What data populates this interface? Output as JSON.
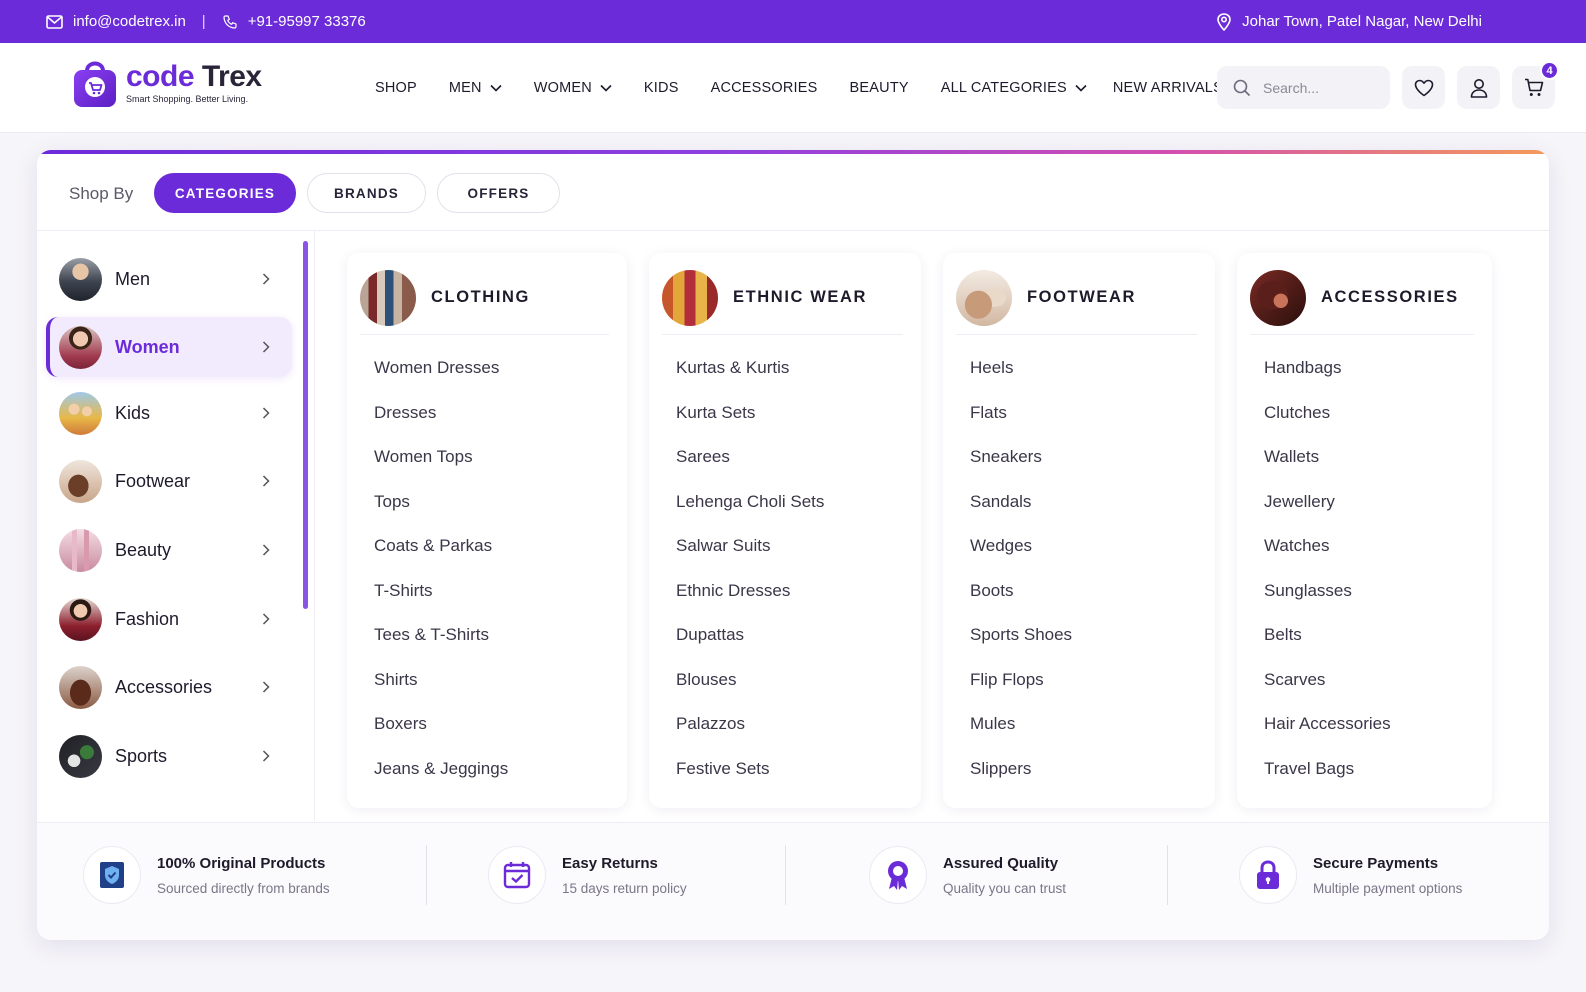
{
  "topbar": {
    "email": "info@codetrex.in",
    "separator": "|",
    "phone": "+91-95997 33376",
    "location": "Johar Town, Patel Nagar, New Delhi"
  },
  "brand": {
    "name_part1": "code",
    "name_part2": " Trex",
    "tagline": "Smart Shopping. Better Living."
  },
  "nav": {
    "items": [
      {
        "label": "SHOP",
        "dropdown": false
      },
      {
        "label": "MEN",
        "dropdown": true
      },
      {
        "label": "WOMEN",
        "dropdown": true
      },
      {
        "label": "KIDS",
        "dropdown": false
      },
      {
        "label": "ACCESSORIES",
        "dropdown": false
      },
      {
        "label": "BEAUTY",
        "dropdown": false
      },
      {
        "label": "ALL CATEGORIES",
        "dropdown": true
      },
      {
        "label": "NEW ARRIVALS",
        "dropdown": false
      }
    ]
  },
  "search": {
    "placeholder": "Search..."
  },
  "cart": {
    "count": "4"
  },
  "shop_by": {
    "label": "Shop By",
    "tabs": [
      "CATEGORIES",
      "BRANDS",
      "OFFERS"
    ],
    "active_tab": "CATEGORIES"
  },
  "sidebar": {
    "items": [
      {
        "label": "Men"
      },
      {
        "label": "Women"
      },
      {
        "label": "Kids"
      },
      {
        "label": "Footwear"
      },
      {
        "label": "Beauty"
      },
      {
        "label": "Fashion"
      },
      {
        "label": "Accessories"
      },
      {
        "label": "Sports"
      }
    ],
    "active": "Women"
  },
  "columns": [
    {
      "title": "CLOTHING",
      "items": [
        "Women Dresses",
        "Dresses",
        "Women Tops",
        "Tops",
        "Coats & Parkas",
        "T-Shirts",
        "Tees & T-Shirts",
        "Shirts",
        "Boxers",
        "Jeans & Jeggings"
      ]
    },
    {
      "title": "ETHNIC WEAR",
      "items": [
        "Kurtas & Kurtis",
        "Kurta Sets",
        "Sarees",
        "Lehenga Choli Sets",
        "Salwar Suits",
        "Ethnic Dresses",
        "Dupattas",
        "Blouses",
        "Palazzos",
        "Festive Sets"
      ]
    },
    {
      "title": "FOOTWEAR",
      "items": [
        "Heels",
        "Flats",
        "Sneakers",
        "Sandals",
        "Wedges",
        "Boots",
        "Sports Shoes",
        "Flip Flops",
        "Mules",
        "Slippers"
      ]
    },
    {
      "title": "ACCESSORIES",
      "items": [
        "Handbags",
        "Clutches",
        "Wallets",
        "Jewellery",
        "Watches",
        "Sunglasses",
        "Belts",
        "Scarves",
        "Hair Accessories",
        "Travel Bags"
      ]
    }
  ],
  "features": [
    {
      "title": "100% Original Products",
      "subtitle": "Sourced directly from brands",
      "icon": "shield-check-icon"
    },
    {
      "title": "Easy Returns",
      "subtitle": "15 days return policy",
      "icon": "calendar-check-icon"
    },
    {
      "title": "Assured Quality",
      "subtitle": "Quality you can trust",
      "icon": "award-ribbon-icon"
    },
    {
      "title": "Secure Payments",
      "subtitle": "Multiple payment options",
      "icon": "lock-icon"
    }
  ],
  "colors": {
    "brand_purple": "#6c2bd9",
    "accent_pink": "#d24fb0",
    "accent_orange": "#f49a5a"
  }
}
